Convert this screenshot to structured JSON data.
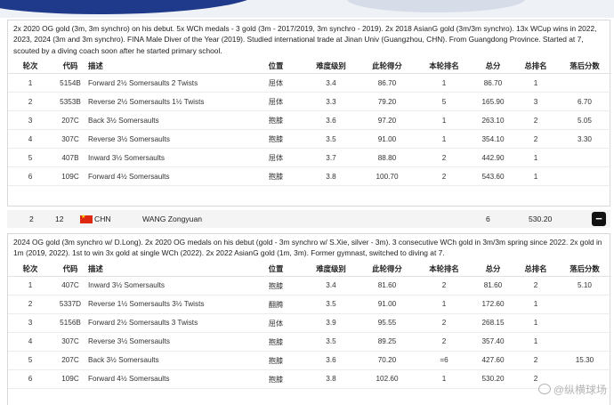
{
  "columns": [
    "轮次",
    "代码",
    "描述",
    "位置",
    "难度级别",
    "此轮得分",
    "本轮排名",
    "总分",
    "总排名",
    "落后分数"
  ],
  "diver1": {
    "bio": "2x 2020 OG gold (3m, 3m synchro) on his debut. 5x WCh medals - 3 gold (3m - 2017/2019, 3m synchro - 2019). 2x 2018 AsianG gold (3m/3m synchro). 13x WCup wins in 2022, 2023, 2024 (3m and 3m synchro). FINA Male Diver of the Year (2019). Studied international trade at Jinan Univ (Guangzhou, CHN). From Guangdong Province. Started at 7, scouted by a diving coach soon after he started primary school.",
    "dives": [
      {
        "round": "1",
        "code": "5154B",
        "desc": "Forward 2½ Somersaults 2 Twists",
        "pos": "屈体",
        "dd": "3.4",
        "score": "86.70",
        "rank": "1",
        "total": "86.70",
        "trank": "1",
        "behind": ""
      },
      {
        "round": "2",
        "code": "5353B",
        "desc": "Reverse 2½ Somersaults 1½ Twists",
        "pos": "屈体",
        "dd": "3.3",
        "score": "79.20",
        "rank": "5",
        "total": "165.90",
        "trank": "3",
        "behind": "6.70"
      },
      {
        "round": "3",
        "code": "207C",
        "desc": "Back 3½ Somersaults",
        "pos": "抱膝",
        "dd": "3.6",
        "score": "97.20",
        "rank": "1",
        "total": "263.10",
        "trank": "2",
        "behind": "5.05"
      },
      {
        "round": "4",
        "code": "307C",
        "desc": "Reverse 3½ Somersaults",
        "pos": "抱膝",
        "dd": "3.5",
        "score": "91.00",
        "rank": "1",
        "total": "354.10",
        "trank": "2",
        "behind": "3.30"
      },
      {
        "round": "5",
        "code": "407B",
        "desc": "Inward 3½ Somersaults",
        "pos": "屈体",
        "dd": "3.7",
        "score": "88.80",
        "rank": "2",
        "total": "442.90",
        "trank": "1",
        "behind": ""
      },
      {
        "round": "6",
        "code": "109C",
        "desc": "Forward 4½ Somersaults",
        "pos": "抱膝",
        "dd": "3.8",
        "score": "100.70",
        "rank": "2",
        "total": "543.60",
        "trank": "1",
        "behind": ""
      }
    ]
  },
  "athlete_row": {
    "rank": "2",
    "bib": "12",
    "country": "CHN",
    "name": "WANG Zongyuan",
    "dives_count": "6",
    "total": "530.20",
    "toggle": "−"
  },
  "diver2": {
    "bio": "2024 OG gold (3m synchro w/ D.Long). 2x 2020 OG medals on his debut (gold - 3m synchro w/ S.Xie, silver - 3m). 3 consecutive WCh gold in 3m/3m spring since 2022. 2x gold in 1m (2019, 2022). 1st to win 3x gold at single WCh (2022). 2x 2022 AsianG gold (1m, 3m). Former gymnast, switched to diving at 7.",
    "dives": [
      {
        "round": "1",
        "code": "407C",
        "desc": "Inward 3½ Somersaults",
        "pos": "抱膝",
        "dd": "3.4",
        "score": "81.60",
        "rank": "2",
        "total": "81.60",
        "trank": "2",
        "behind": "5.10"
      },
      {
        "round": "2",
        "code": "5337D",
        "desc": "Reverse 1½ Somersaults 3½ Twists",
        "pos": "翻腾",
        "dd": "3.5",
        "score": "91.00",
        "rank": "1",
        "total": "172.60",
        "trank": "1",
        "behind": ""
      },
      {
        "round": "3",
        "code": "5156B",
        "desc": "Forward 2½ Somersaults 3 Twists",
        "pos": "屈体",
        "dd": "3.9",
        "score": "95.55",
        "rank": "2",
        "total": "268.15",
        "trank": "1",
        "behind": ""
      },
      {
        "round": "4",
        "code": "307C",
        "desc": "Reverse 3½ Somersaults",
        "pos": "抱膝",
        "dd": "3.5",
        "score": "89.25",
        "rank": "2",
        "total": "357.40",
        "trank": "1",
        "behind": ""
      },
      {
        "round": "5",
        "code": "207C",
        "desc": "Back 3½ Somersaults",
        "pos": "抱膝",
        "dd": "3.6",
        "score": "70.20",
        "rank": "=6",
        "total": "427.60",
        "trank": "2",
        "behind": "15.30"
      },
      {
        "round": "6",
        "code": "109C",
        "desc": "Forward 4½ Somersaults",
        "pos": "抱膝",
        "dd": "3.8",
        "score": "102.60",
        "rank": "1",
        "total": "530.20",
        "trank": "2",
        "behind": ""
      }
    ]
  },
  "watermark": "@纵横球场"
}
